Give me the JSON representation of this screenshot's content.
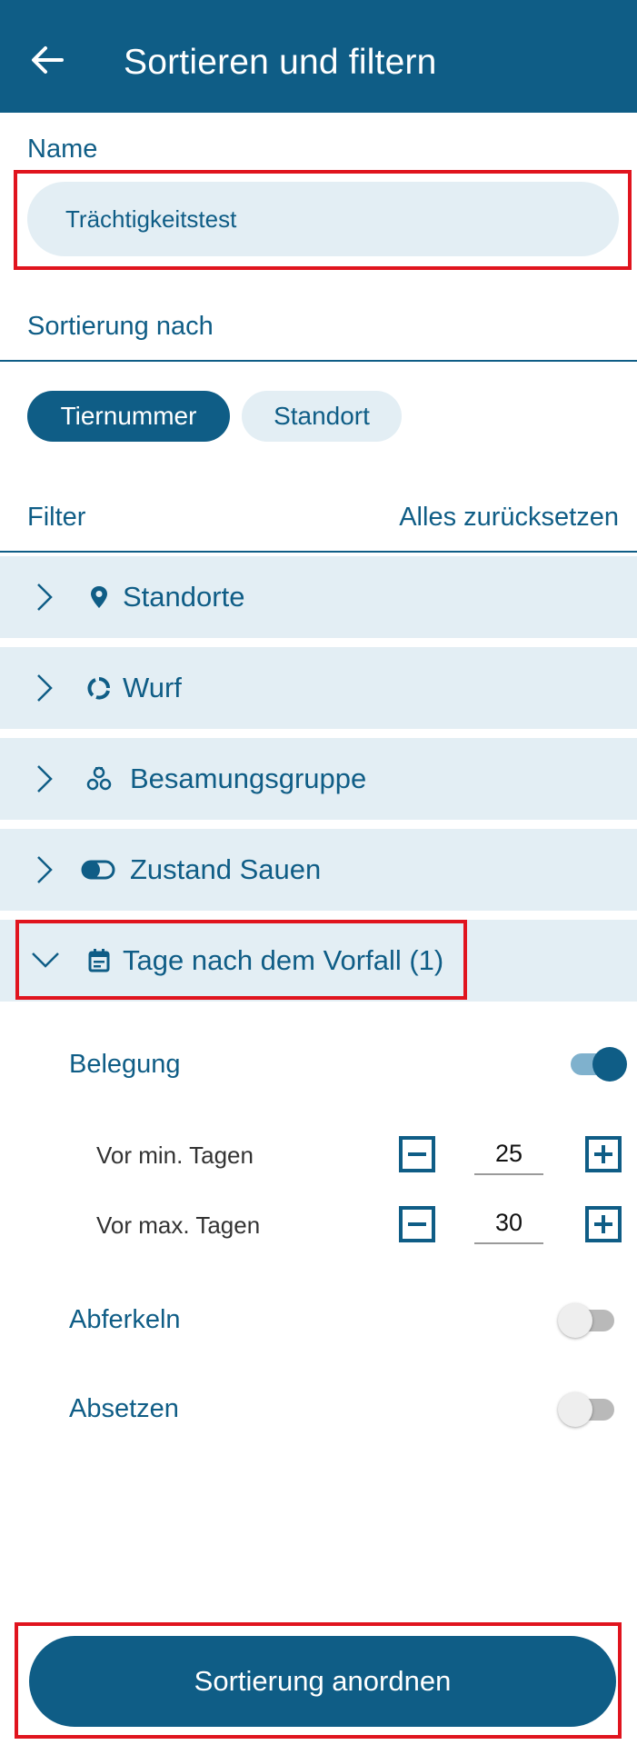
{
  "header": {
    "title": "Sortieren und filtern",
    "back_icon": "arrow-left-icon"
  },
  "name": {
    "label": "Name",
    "value": "Trächtigkeitstest"
  },
  "sorting": {
    "label": "Sortierung nach",
    "options": [
      {
        "label": "Tiernummer",
        "selected": true
      },
      {
        "label": "Standort",
        "selected": false
      }
    ]
  },
  "filter": {
    "label": "Filter",
    "reset_label": "Alles zurücksetzen",
    "sections": [
      {
        "label": "Standorte",
        "icon": "location-pin-icon",
        "expanded": false
      },
      {
        "label": "Wurf",
        "icon": "circle-arrows-icon",
        "expanded": false
      },
      {
        "label": "Besamungsgruppe",
        "icon": "pig-group-icon",
        "expanded": false
      },
      {
        "label": "Zustand Sauen",
        "icon": "toggle-status-icon",
        "expanded": false
      },
      {
        "label": "Tage nach dem Vorfall (1)",
        "icon": "calendar-icon",
        "expanded": true
      }
    ],
    "events": {
      "belegung": {
        "label": "Belegung",
        "enabled": true
      },
      "min_days": {
        "label": "Vor min. Tagen",
        "value": "25"
      },
      "max_days": {
        "label": "Vor max. Tagen",
        "value": "30"
      },
      "abferkeln": {
        "label": "Abferkeln",
        "enabled": false
      },
      "absetzen": {
        "label": "Absetzen",
        "enabled": false
      }
    }
  },
  "footer": {
    "apply_label": "Sortierung anordnen"
  },
  "colors": {
    "primary": "#0f5d86",
    "section_bg": "#e3eef4",
    "highlight": "#e0141e"
  }
}
